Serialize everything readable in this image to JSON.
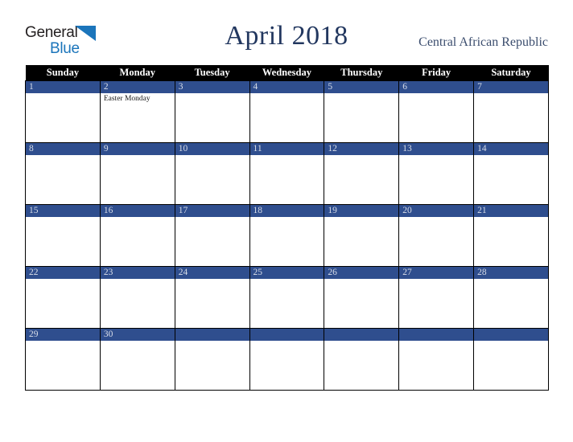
{
  "brand": {
    "word_one": "General",
    "word_two": "Blue",
    "triangle_icon": "blue-triangle-icon",
    "accent_color": "#1b75bb",
    "text_color": "#231f20"
  },
  "header": {
    "month_title": "April 2018",
    "country": "Central African Republic",
    "title_color": "#22375f",
    "country_color": "#3b4d6e"
  },
  "calendar": {
    "header_background": "#000000",
    "header_text_color": "#ffffff",
    "date_band_color": "#2f4e8e",
    "date_text_color": "#d8dde8",
    "grid_border_color": "#000000",
    "weekday_headers": [
      "Sunday",
      "Monday",
      "Tuesday",
      "Wednesday",
      "Thursday",
      "Friday",
      "Saturday"
    ],
    "weeks": [
      [
        {
          "date": "1",
          "events": []
        },
        {
          "date": "2",
          "events": [
            "Easter Monday"
          ]
        },
        {
          "date": "3",
          "events": []
        },
        {
          "date": "4",
          "events": []
        },
        {
          "date": "5",
          "events": []
        },
        {
          "date": "6",
          "events": []
        },
        {
          "date": "7",
          "events": []
        }
      ],
      [
        {
          "date": "8",
          "events": []
        },
        {
          "date": "9",
          "events": []
        },
        {
          "date": "10",
          "events": []
        },
        {
          "date": "11",
          "events": []
        },
        {
          "date": "12",
          "events": []
        },
        {
          "date": "13",
          "events": []
        },
        {
          "date": "14",
          "events": []
        }
      ],
      [
        {
          "date": "15",
          "events": []
        },
        {
          "date": "16",
          "events": []
        },
        {
          "date": "17",
          "events": []
        },
        {
          "date": "18",
          "events": []
        },
        {
          "date": "19",
          "events": []
        },
        {
          "date": "20",
          "events": []
        },
        {
          "date": "21",
          "events": []
        }
      ],
      [
        {
          "date": "22",
          "events": []
        },
        {
          "date": "23",
          "events": []
        },
        {
          "date": "24",
          "events": []
        },
        {
          "date": "25",
          "events": []
        },
        {
          "date": "26",
          "events": []
        },
        {
          "date": "27",
          "events": []
        },
        {
          "date": "28",
          "events": []
        }
      ],
      [
        {
          "date": "29",
          "events": []
        },
        {
          "date": "30",
          "events": []
        },
        {
          "date": "",
          "events": []
        },
        {
          "date": "",
          "events": []
        },
        {
          "date": "",
          "events": []
        },
        {
          "date": "",
          "events": []
        },
        {
          "date": "",
          "events": []
        }
      ]
    ]
  }
}
